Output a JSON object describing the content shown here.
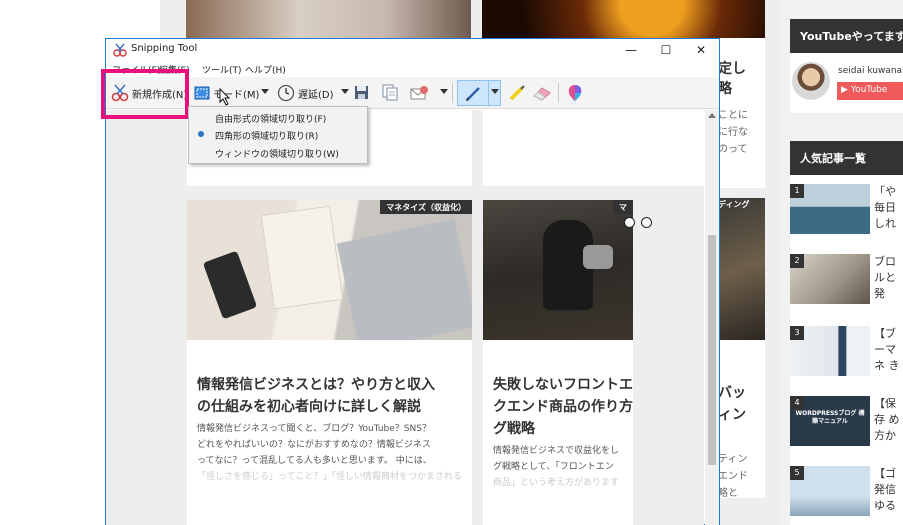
{
  "background": {
    "sidebar": {
      "youtube_heading": "YouTubeやってます",
      "channel_name": "seidai kuwana",
      "youtube_button": "YouTube",
      "popular_heading": "人気記事一覧",
      "popular_items": [
        {
          "rank": "1",
          "text": "「や 毎日 しれか"
        },
        {
          "rank": "2",
          "text": "ブロ ルと発"
        },
        {
          "rank": "3",
          "text": "【ブ ーマネ き出す"
        },
        {
          "rank": "4",
          "text": "【保存 め方か ュアル",
          "thumb_caption": "WORDPRESSブログ 構築マニュアル"
        },
        {
          "rank": "5",
          "text": "【ゴ 発信 ゆる"
        }
      ]
    },
    "peek_texts": [
      "定し",
      "略",
      "ことに",
      "に行な",
      "のって"
    ],
    "peek_texts_lower": [
      "バッ",
      "ィン",
      "ティン",
      "エンド",
      "略と"
    ],
    "peek_tag": "ディング"
  },
  "snip_window": {
    "title": "Snipping Tool",
    "menu": [
      "ファイル(F)",
      "編集(E)",
      "ツール(T)",
      "ヘルプ(H)"
    ],
    "toolbar": {
      "new_label": "新規作成(N)",
      "mode_label": "モード(M)",
      "delay_label": "遅延(D)"
    },
    "mode_dropdown": [
      "自由形式の領域切り取り(F)",
      "四角形の領域切り取り(R)",
      "ウィンドウの領域切り取り(W)"
    ],
    "selected_mode_index": 1,
    "controls": {
      "minimize": "—",
      "maximize": "☐",
      "close": "✕"
    }
  },
  "articles": [
    {
      "tag": "マネタイズ（収益化）",
      "title_line1": "情報発信ビジネスとは？やり方と収入",
      "title_line2": "の仕組みを初心者向けに詳しく解説",
      "excerpt": [
        "情報発信ビジネスって聞くと、ブログ？YouTube？SNS？",
        "どれをやればいいの？なにがおすすめなの？情報ビジネス",
        "ってなに？って混乱してる人も多いと思います。 中には、",
        "「怪しさを感じる」ってこと？」「怪しい情報商材をつかまされる"
      ]
    },
    {
      "tag": "マ",
      "title_line1": "失敗しないフロントエ",
      "title_line2": "クエンド商品の作り方",
      "title_line3": "グ戦略",
      "excerpt": [
        "情報発信ビジネスで収益化をし",
        "グ戦略として、「フロントエン",
        "商品」という考え方があります"
      ]
    }
  ],
  "colors": {
    "highlight": "#e8107a",
    "window_border": "#1e7bd2",
    "pen_active": "#cde6fb",
    "dropdown_selected_dot": "#2b74c7"
  }
}
